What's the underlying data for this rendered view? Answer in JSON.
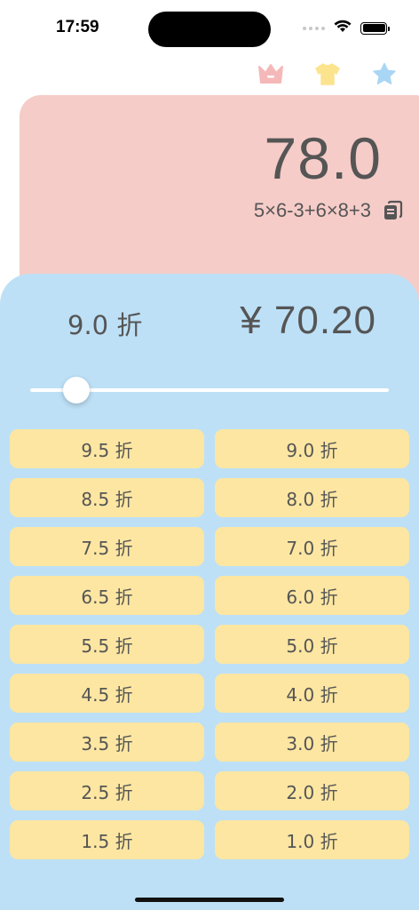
{
  "status_bar": {
    "time": "17:59"
  },
  "header_icons": [
    {
      "icon": "crown-icon",
      "color": "#f5b8b8"
    },
    {
      "icon": "shirt-icon",
      "color": "#fce48f"
    },
    {
      "icon": "star-icon",
      "color": "#a9d6f5"
    }
  ],
  "calculator": {
    "result": "78.0",
    "expression": "5×6-3+6×8+3",
    "background": "#f5ccc8"
  },
  "discount": {
    "current_label": "9.0 折",
    "price": "¥ 70.20",
    "slider_value": 0.9,
    "background": "#bde0f6",
    "button_color": "#fce6a2",
    "buttons": [
      [
        "9.5 折",
        "9.0 折"
      ],
      [
        "8.5 折",
        "8.0 折"
      ],
      [
        "7.5 折",
        "7.0 折"
      ],
      [
        "6.5 折",
        "6.0 折"
      ],
      [
        "5.5 折",
        "5.0 折"
      ],
      [
        "4.5 折",
        "4.0 折"
      ],
      [
        "3.5 折",
        "3.0 折"
      ],
      [
        "2.5 折",
        "2.0 折"
      ],
      [
        "1.5 折",
        "1.0 折"
      ]
    ]
  }
}
